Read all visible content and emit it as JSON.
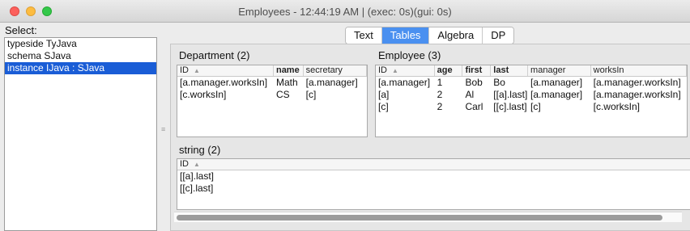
{
  "window": {
    "title": "Employees - 12:44:19 AM | (exec: 0s)(gui: 0s)"
  },
  "left": {
    "select_label": "Select:",
    "items": [
      "typeside TyJava",
      "schema SJava",
      "instance IJava : SJava"
    ],
    "selected_index": 2
  },
  "tabs": [
    {
      "label": "Text",
      "active": false
    },
    {
      "label": "Tables",
      "active": true
    },
    {
      "label": "Algebra",
      "active": false
    },
    {
      "label": "DP",
      "active": false
    }
  ],
  "department": {
    "title": "Department (2)",
    "columns": [
      "ID",
      "name",
      "secretary"
    ],
    "sort_indicator": "▲",
    "rows": [
      [
        "[a.manager.worksIn]",
        "Math",
        "[a.manager]"
      ],
      [
        "[c.worksIn]",
        "CS",
        "[c]"
      ]
    ]
  },
  "employee": {
    "title": "Employee (3)",
    "columns": [
      "ID",
      "age",
      "first",
      "last",
      "manager",
      "worksIn"
    ],
    "sort_indicator": "▲",
    "rows": [
      [
        "[a.manager]",
        "1",
        "Bob",
        "Bo",
        "[a.manager]",
        "[a.manager.worksIn]"
      ],
      [
        "[a]",
        "2",
        "Al",
        "[[a].last]",
        "[a.manager]",
        "[a.manager.worksIn]"
      ],
      [
        "[c]",
        "2",
        "Carl",
        "[[c].last]",
        "[c]",
        "[c.worksIn]"
      ]
    ]
  },
  "string": {
    "title": "string (2)",
    "columns": [
      "ID"
    ],
    "sort_indicator": "▲",
    "rows": [
      [
        "[[a].last]"
      ],
      [
        "[[c].last]"
      ]
    ]
  },
  "colors": {
    "selection": "#1a5dd6",
    "tab_active": "#4a90f0"
  }
}
